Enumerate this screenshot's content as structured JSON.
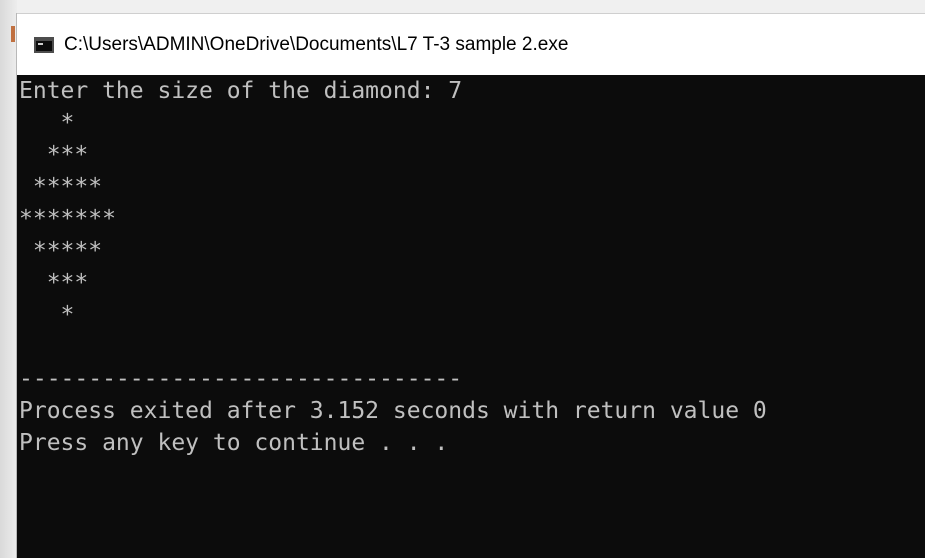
{
  "window": {
    "title": "C:\\Users\\ADMIN\\OneDrive\\Documents\\L7 T-3 sample 2.exe"
  },
  "console": {
    "lines": [
      "Enter the size of the diamond: 7",
      "   *",
      "  ***",
      " *****",
      "*******",
      " *****",
      "  ***",
      "   *",
      "",
      "--------------------------------",
      "Process exited after 3.152 seconds with return value 0",
      "Press any key to continue . . ."
    ]
  },
  "colors": {
    "console_background": "#0c0c0c",
    "console_text": "#c0c0c0",
    "titlebar_background": "#ffffff",
    "title_text": "#000000"
  },
  "icons": {
    "app": "console-window-icon"
  }
}
